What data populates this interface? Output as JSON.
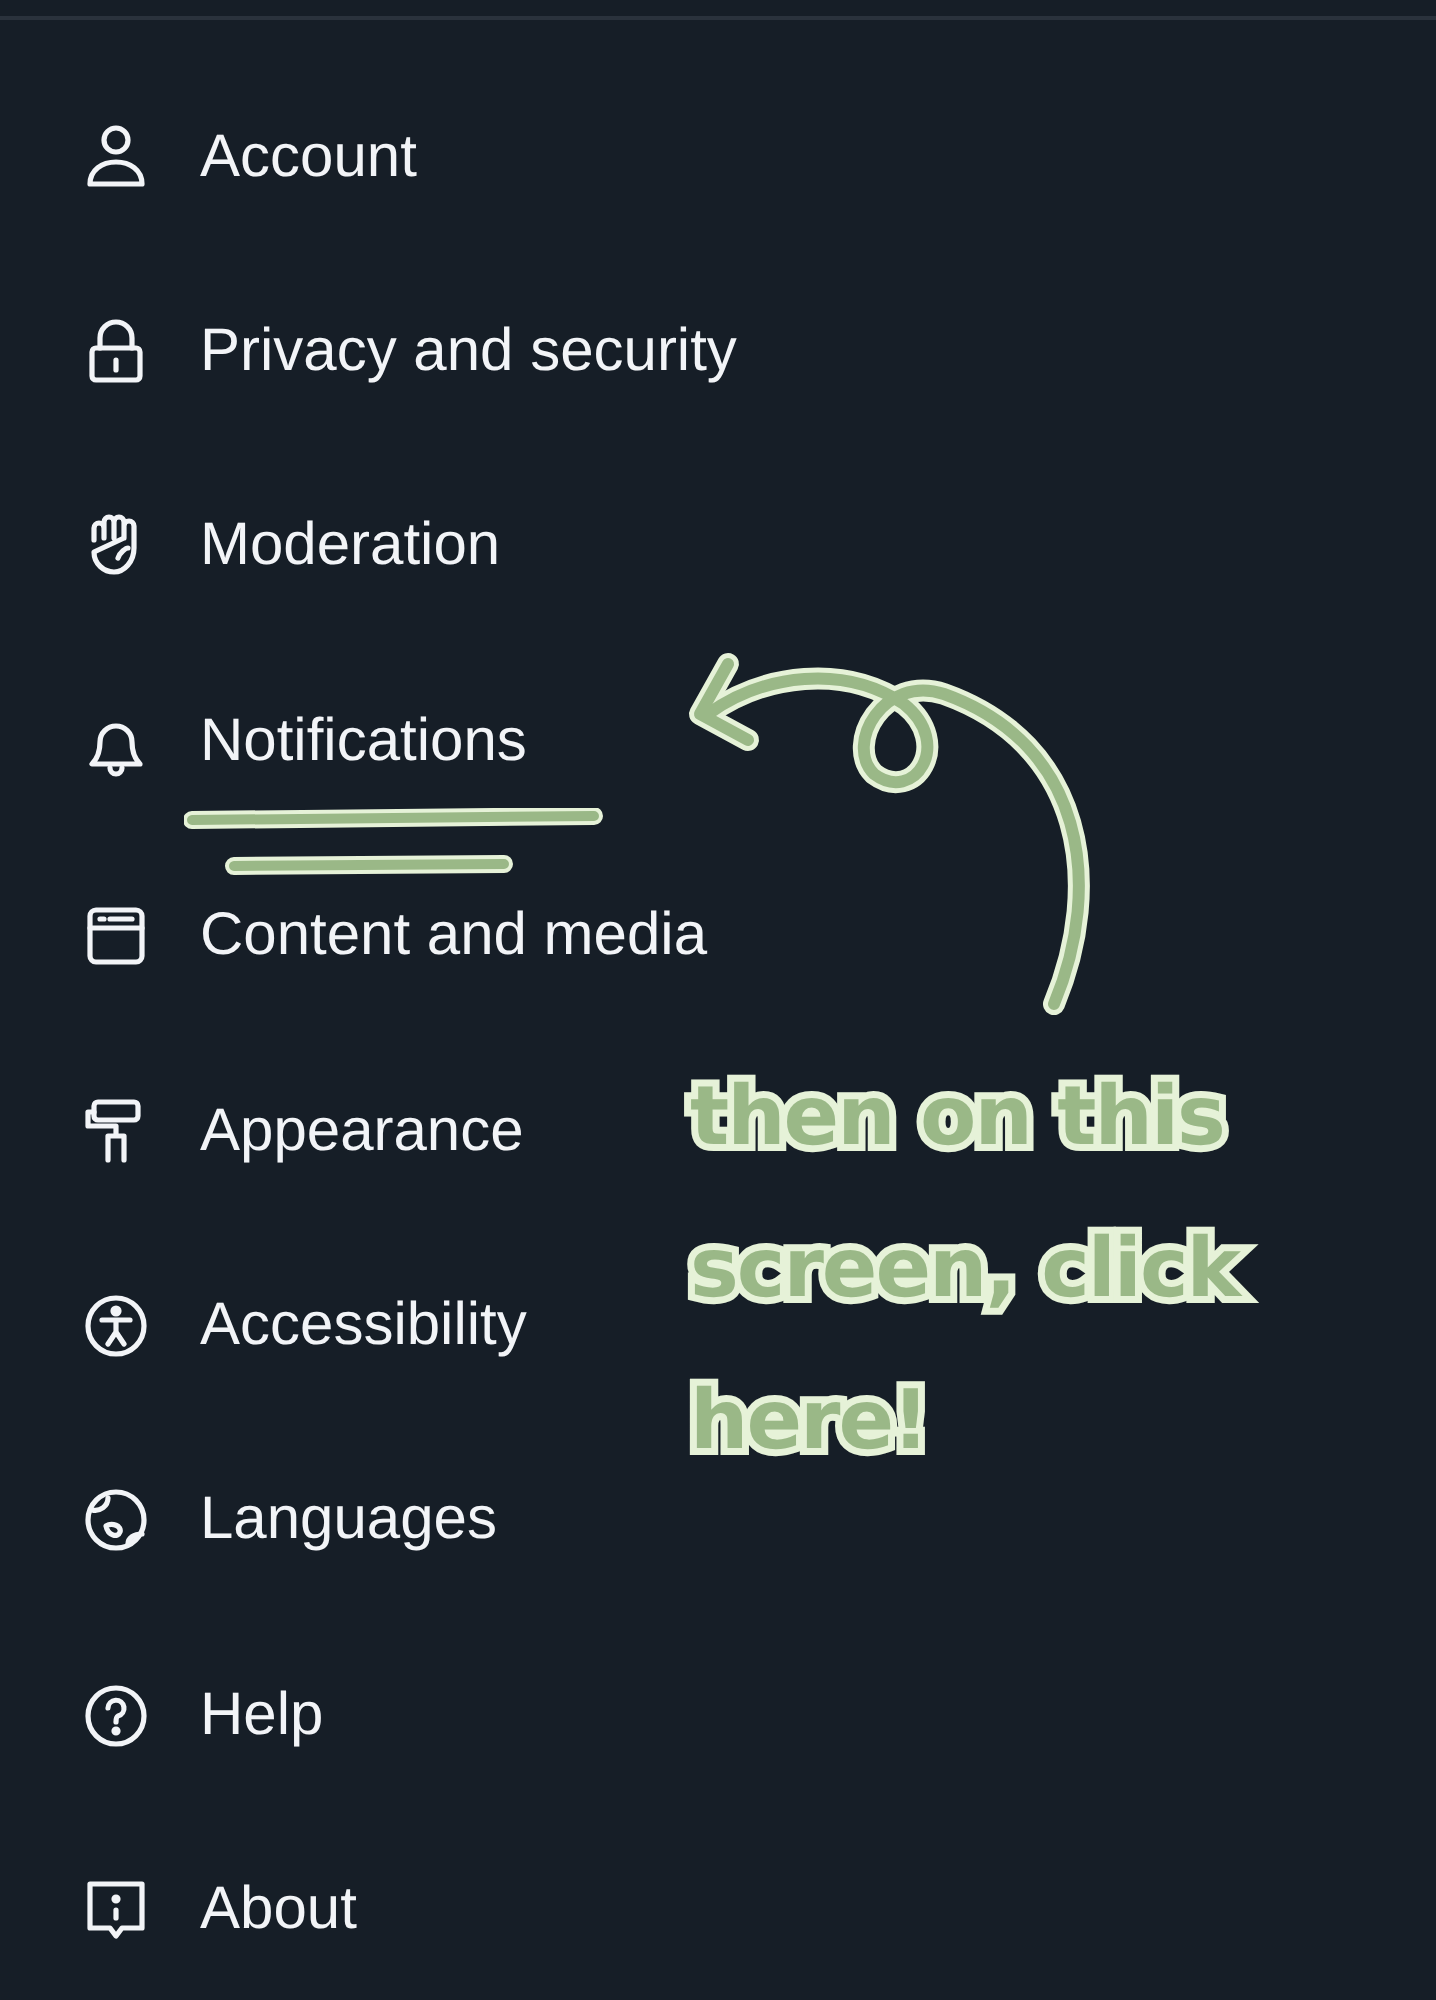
{
  "menu": [
    {
      "kind": "account",
      "label": "Account",
      "highlighted": false
    },
    {
      "kind": "privacy",
      "label": "Privacy and security",
      "highlighted": false
    },
    {
      "kind": "moderation",
      "label": "Moderation",
      "highlighted": false
    },
    {
      "kind": "notifications",
      "label": "Notifications",
      "highlighted": true
    },
    {
      "kind": "content",
      "label": "Content and media",
      "highlighted": false
    },
    {
      "kind": "appearance",
      "label": "Appearance",
      "highlighted": false
    },
    {
      "kind": "accessibility",
      "label": "Accessibility",
      "highlighted": false
    },
    {
      "kind": "languages",
      "label": "Languages",
      "highlighted": false
    },
    {
      "kind": "help",
      "label": "Help",
      "highlighted": false
    },
    {
      "kind": "about",
      "label": "About",
      "highlighted": false
    }
  ],
  "annotation": {
    "text": "then on this screen, click here!"
  }
}
